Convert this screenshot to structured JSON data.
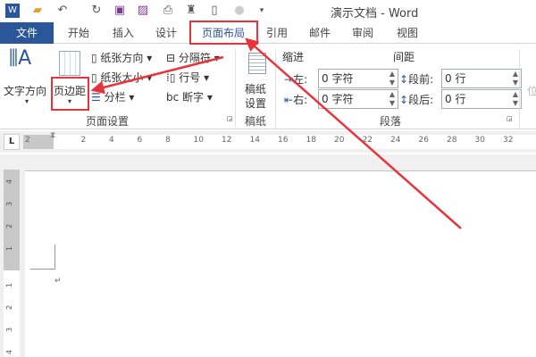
{
  "title": "演示文档 - Word",
  "quick_access": [
    "word-icon",
    "open-icon",
    "undo-icon",
    "redo-icon",
    "save-icon",
    "save-as-icon",
    "print-preview-icon",
    "find-icon",
    "new-icon",
    "circle-icon",
    "customize-icon"
  ],
  "tabs": {
    "file": "文件",
    "items": [
      "开始",
      "插入",
      "设计",
      "页面布局",
      "引用",
      "邮件",
      "审阅",
      "视图"
    ],
    "active": "页面布局"
  },
  "ribbon": {
    "text_direction": "文字方向",
    "margins": "页边距",
    "orientation": "纸张方向",
    "size": "纸张大小",
    "columns": "分栏",
    "breaks": "分隔符",
    "line_numbers": "行号",
    "hyphenation": "断字",
    "page_setup_group": "页面设置",
    "manuscript_line1": "稿纸",
    "manuscript_line2": "设置",
    "manuscript_group": "稿纸",
    "indent_label": "缩进",
    "spacing_label": "间距",
    "left": "左:",
    "right": "右:",
    "left_value": "0 字符",
    "right_value": "0 字符",
    "before": "段前:",
    "after": "段后:",
    "before_value": "0 行",
    "after_value": "0 行",
    "paragraph_group": "段落",
    "position_partial": "位"
  },
  "ruler": {
    "marks": [
      "2",
      "2",
      "4",
      "6",
      "8",
      "10",
      "12",
      "14",
      "16",
      "18",
      "20",
      "22",
      "24",
      "26",
      "28",
      "30",
      "32"
    ],
    "tab_selector": "L"
  },
  "vruler": [
    "4",
    "3",
    "2",
    "1",
    "1",
    "2",
    "3",
    "4"
  ],
  "doc": {
    "paragraph_mark": "↵"
  },
  "colors": {
    "file_tab": "#2b579a",
    "annotation": "#e8333a",
    "active_tab_text": "#2b579a"
  }
}
